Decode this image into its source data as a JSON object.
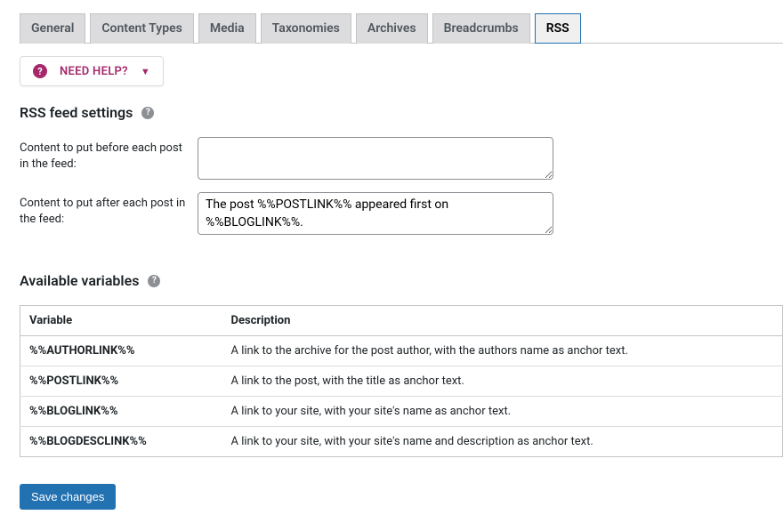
{
  "tabs": [
    {
      "label": "General"
    },
    {
      "label": "Content Types"
    },
    {
      "label": "Media"
    },
    {
      "label": "Taxonomies"
    },
    {
      "label": "Archives"
    },
    {
      "label": "Breadcrumbs"
    },
    {
      "label": "RSS"
    }
  ],
  "help_button_label": "NEED HELP?",
  "section_rss_heading": "RSS feed settings",
  "form": {
    "before_label": "Content to put before each post in the feed:",
    "before_value": "",
    "after_label": "Content to put after each post in the feed:",
    "after_value": "The post %%POSTLINK%% appeared first on %%BLOGLINK%%."
  },
  "section_vars_heading": "Available variables",
  "vars_table": {
    "headers": {
      "variable": "Variable",
      "description": "Description"
    },
    "rows": [
      {
        "variable": "%%AUTHORLINK%%",
        "description": "A link to the archive for the post author, with the authors name as anchor text."
      },
      {
        "variable": "%%POSTLINK%%",
        "description": "A link to the post, with the title as anchor text."
      },
      {
        "variable": "%%BLOGLINK%%",
        "description": "A link to your site, with your site's name as anchor text."
      },
      {
        "variable": "%%BLOGDESCLINK%%",
        "description": "A link to your site, with your site's name and description as anchor text."
      }
    ]
  },
  "save_button_label": "Save changes"
}
